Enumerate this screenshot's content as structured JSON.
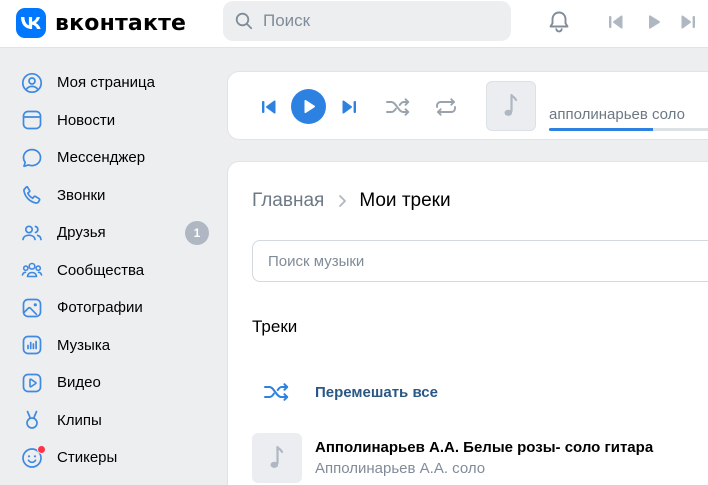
{
  "brand": {
    "name": "вконтакте"
  },
  "search": {
    "placeholder": "Поиск"
  },
  "sidebar": {
    "items": [
      {
        "label": "Моя страница",
        "icon": "user-circle-icon"
      },
      {
        "label": "Новости",
        "icon": "newsfeed-icon"
      },
      {
        "label": "Мессенджер",
        "icon": "message-icon"
      },
      {
        "label": "Звонки",
        "icon": "phone-icon"
      },
      {
        "label": "Друзья",
        "icon": "friends-icon",
        "badge": "1"
      },
      {
        "label": "Сообщества",
        "icon": "communities-icon"
      },
      {
        "label": "Фотографии",
        "icon": "photo-icon"
      },
      {
        "label": "Музыка",
        "icon": "music-icon"
      },
      {
        "label": "Видео",
        "icon": "video-icon"
      },
      {
        "label": "Клипы",
        "icon": "clips-icon"
      },
      {
        "label": "Стикеры",
        "icon": "stickers-icon"
      }
    ]
  },
  "player": {
    "track_title": "апполинарьев соло",
    "progress": 0.65
  },
  "main": {
    "breadcrumb": {
      "home": "Главная",
      "current": "Мои треки"
    },
    "search_placeholder": "Поиск музыки",
    "section_title": "Треки",
    "shuffle_label": "Перемешать все",
    "tracks": [
      {
        "title": "Апполинарьев А.А. Белые розы- соло гитара",
        "artist": "Апполинарьев А.А. соло"
      }
    ]
  },
  "colors": {
    "accent": "#2d81e0",
    "brand": "#0077ff",
    "link": "#2a5885",
    "icon": "#3f8ae0",
    "notification": "#ff3347"
  }
}
